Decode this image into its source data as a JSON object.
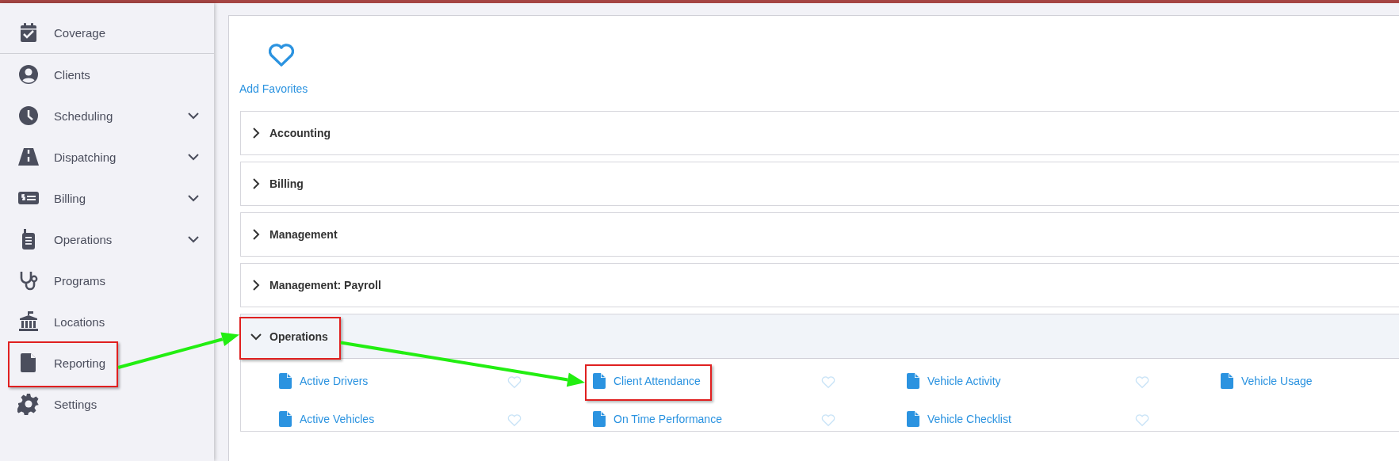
{
  "sidebar": {
    "items": [
      {
        "label": "Coverage",
        "highlighted": false
      },
      {
        "label": "Clients",
        "highlighted": false
      },
      {
        "label": "Scheduling",
        "expanded": false,
        "highlighted": false
      },
      {
        "label": "Dispatching",
        "expanded": false,
        "highlighted": false
      },
      {
        "label": "Billing",
        "expanded": false,
        "highlighted": false
      },
      {
        "label": "Operations",
        "expanded": false,
        "highlighted": false
      },
      {
        "label": "Programs",
        "highlighted": false
      },
      {
        "label": "Locations",
        "highlighted": false
      },
      {
        "label": "Reporting",
        "highlighted": true
      },
      {
        "label": "Settings",
        "highlighted": false
      }
    ]
  },
  "favorites": {
    "label": "Add Favorites"
  },
  "sections": [
    {
      "title": "Accounting",
      "expanded": false,
      "highlighted": false
    },
    {
      "title": "Billing",
      "expanded": false,
      "highlighted": false
    },
    {
      "title": "Management",
      "expanded": false,
      "highlighted": false
    },
    {
      "title": "Management: Payroll",
      "expanded": false,
      "highlighted": false
    },
    {
      "title": "Operations",
      "expanded": true,
      "highlighted": true,
      "reports": [
        {
          "label": "Active Drivers",
          "favorite": false,
          "highlighted": false
        },
        {
          "label": "Client Attendance",
          "favorite": false,
          "highlighted": true
        },
        {
          "label": "Vehicle Activity",
          "favorite": false,
          "highlighted": false
        },
        {
          "label": "Vehicle Usage",
          "highlighted": false
        },
        {
          "label": "Active Vehicles",
          "favorite": false,
          "highlighted": false
        },
        {
          "label": "On Time Performance",
          "favorite": false,
          "highlighted": false
        },
        {
          "label": "Vehicle Checklist",
          "favorite": false,
          "highlighted": false
        }
      ]
    }
  ],
  "callout_arrows": true
}
